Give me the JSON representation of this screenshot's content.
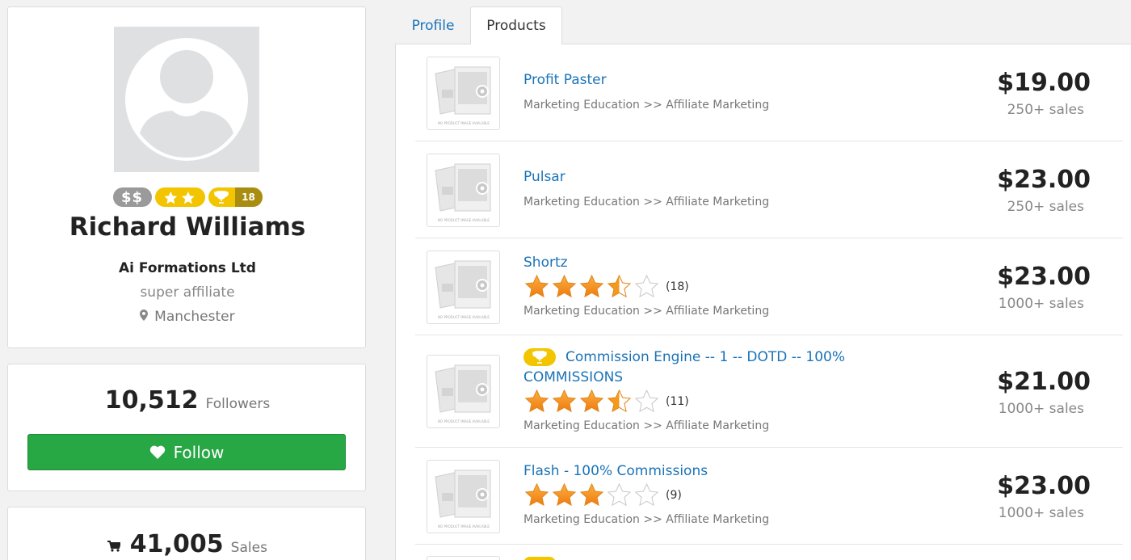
{
  "profile": {
    "name": "Richard Williams",
    "company": "Ai Formations Ltd",
    "role": "super affiliate",
    "location": "Manchester",
    "badges": {
      "money": "$$",
      "trophy_count": "18"
    }
  },
  "followers": {
    "count": "10,512",
    "label": "Followers",
    "follow_button": "Follow"
  },
  "sales": {
    "count": "41,005",
    "label": "Sales"
  },
  "tabs": [
    {
      "label": "Profile"
    },
    {
      "label": "Products",
      "active": true
    }
  ],
  "products": [
    {
      "name": "Profit Paster",
      "category": "Marketing Education >> Affiliate Marketing",
      "price": "$19.00",
      "sales": "250+ sales"
    },
    {
      "name": "Pulsar",
      "category": "Marketing Education >> Affiliate Marketing",
      "price": "$23.00",
      "sales": "250+ sales"
    },
    {
      "name": "Shortz",
      "category": "Marketing Education >> Affiliate Marketing",
      "price": "$23.00",
      "sales": "1000+ sales",
      "rating": 3.5,
      "rating_count": "(18)"
    },
    {
      "name_line1": "Commission Engine -- 1 -- DOTD -- 100%",
      "name_line2": "COMMISSIONS",
      "trophy": true,
      "category": "Marketing Education >> Affiliate Marketing",
      "price": "$21.00",
      "sales": "1000+ sales",
      "rating": 3.5,
      "rating_count": "(11)"
    },
    {
      "name": "Flash - 100% Commissions",
      "category": "Marketing Education >> Affiliate Marketing",
      "price": "$23.00",
      "sales": "1000+ sales",
      "rating": 3,
      "rating_count": "(9)"
    }
  ],
  "colors": {
    "follow_green": "#28a745",
    "link_blue": "#1a73b8",
    "badge_gold": "#f2c500",
    "badge_gray": "#9a9a9a",
    "star_orange": "#f39a1e"
  }
}
